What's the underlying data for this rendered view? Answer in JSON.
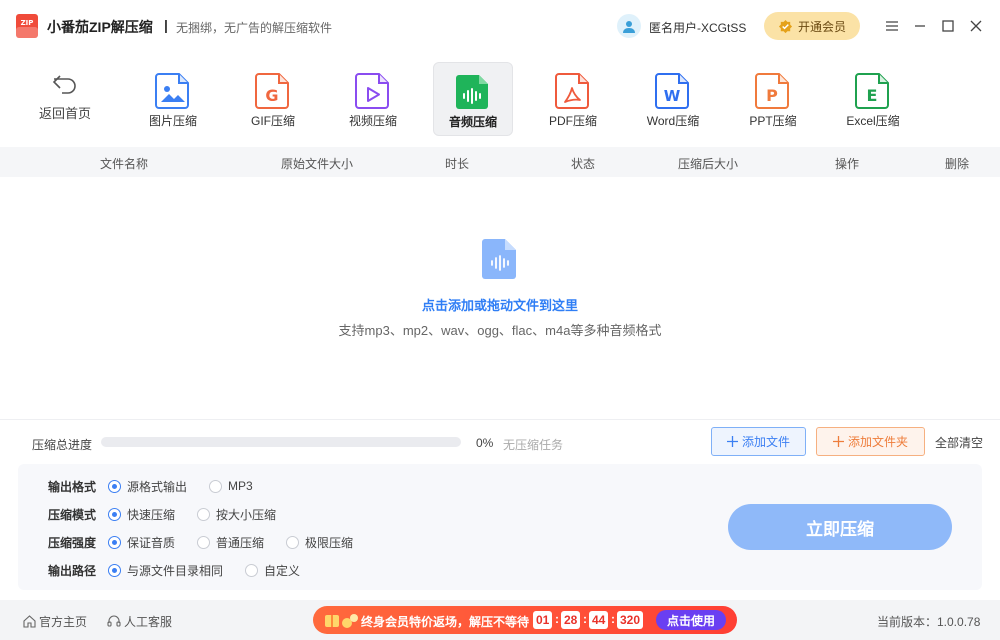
{
  "titlebar": {
    "logo_text": "ZIP",
    "app_name": "小番茄ZIP解压缩",
    "separator": "|",
    "tagline": "无捆绑，无广告的解压缩软件",
    "user_name": "匿名用户-XCGtSS",
    "vip_label": "开通会员"
  },
  "toolbar": {
    "back_label": "返回首页",
    "tools": [
      {
        "label": "图片压缩",
        "icon": "image-file-icon",
        "color": "#3b7ff3"
      },
      {
        "label": "GIF压缩",
        "icon": "gif-file-icon",
        "color": "#f0673f"
      },
      {
        "label": "视频压缩",
        "icon": "video-file-icon",
        "color": "#8a4cf0"
      },
      {
        "label": "音频压缩",
        "icon": "audio-file-icon",
        "color": "#1fb45a",
        "active": true
      },
      {
        "label": "PDF压缩",
        "icon": "pdf-file-icon",
        "color": "#ef5a3c"
      },
      {
        "label": "Word压缩",
        "icon": "word-file-icon",
        "color": "#2f6ff0"
      },
      {
        "label": "PPT压缩",
        "icon": "ppt-file-icon",
        "color": "#f07a3c"
      },
      {
        "label": "Excel压缩",
        "icon": "excel-file-icon",
        "color": "#1fa14f"
      }
    ]
  },
  "table": {
    "headers": [
      "文件名称",
      "原始文件大小",
      "时长",
      "状态",
      "压缩后大小",
      "操作",
      "删除"
    ]
  },
  "dropzone": {
    "main_text": "点击添加或拖动文件到这里",
    "sub_text": "支持mp3、mp2、wav、ogg、flac、m4a等多种音频格式"
  },
  "progress": {
    "label": "压缩总进度",
    "value": 0,
    "percent_text": "0%",
    "status": "无压缩任务"
  },
  "actions": {
    "add_file": "添加文件",
    "add_folder": "添加文件夹",
    "clear_all": "全部清空"
  },
  "settings": {
    "rows": [
      {
        "label": "输出格式",
        "options": [
          "源格式输出",
          "MP3"
        ],
        "selected": 0
      },
      {
        "label": "压缩模式",
        "options": [
          "快速压缩",
          "按大小压缩"
        ],
        "selected": 0
      },
      {
        "label": "压缩强度",
        "options": [
          "保证音质",
          "普通压缩",
          "极限压缩"
        ],
        "selected": 0
      },
      {
        "label": "输出路径",
        "options": [
          "与源文件目录相同",
          "自定义"
        ],
        "selected": 0
      }
    ],
    "compress_label": "立即压缩"
  },
  "footer": {
    "home_link": "官方主页",
    "support_link": "人工客服",
    "promo_text": "终身会员特价返场，解压不等待",
    "countdown": [
      "01",
      "28",
      "44",
      "320"
    ],
    "promo_button": "点击使用",
    "version": "当前版本：1.0.0.78"
  },
  "colors": {
    "accent": "#3b7ff3",
    "vip_bg": "#fbe2a6",
    "compress_button": "#8fb9f9",
    "add_folder": "#ee7d3b"
  }
}
